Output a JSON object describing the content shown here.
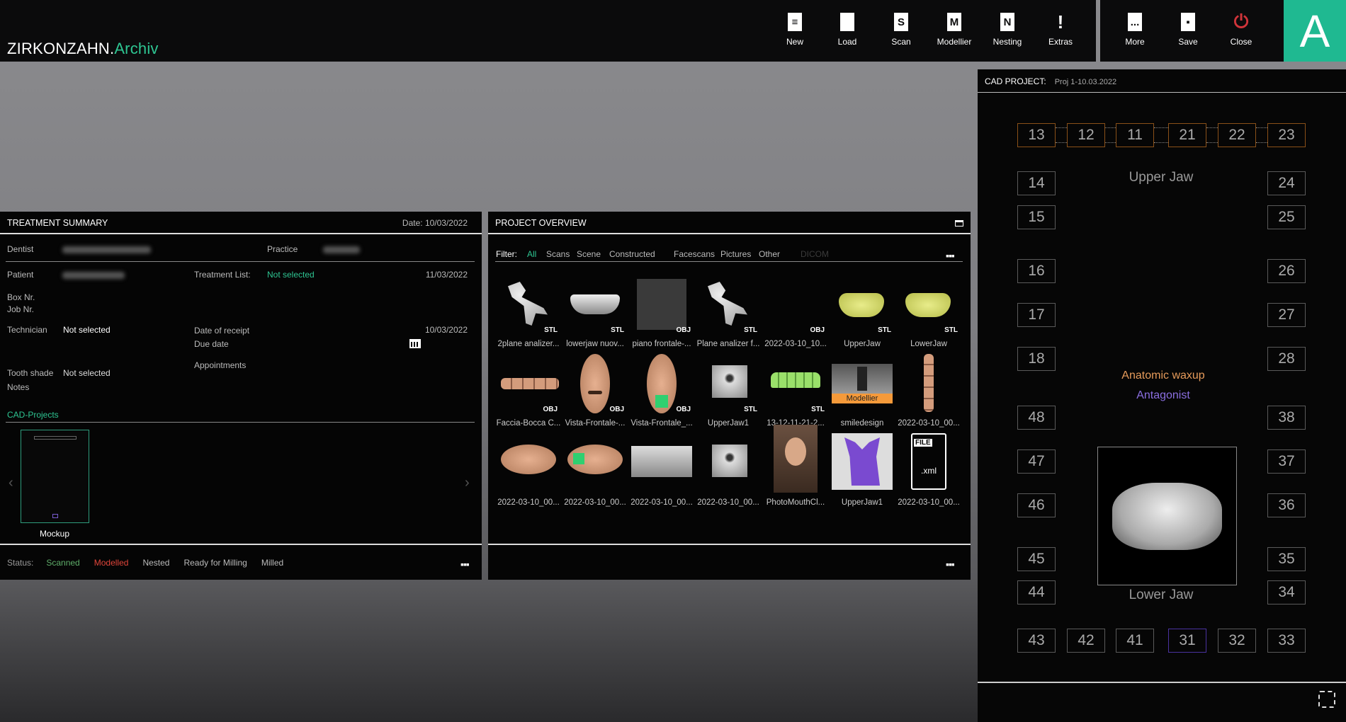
{
  "app": {
    "brand": "ZIRKONZAHN.",
    "product": "Archiv",
    "user_initial": "A",
    "accent": "#1fb991"
  },
  "toolbar": [
    {
      "label": "New",
      "icon": "new-file-icon",
      "glyph": "≡"
    },
    {
      "label": "Load",
      "icon": "folder-icon",
      "glyph": ""
    },
    {
      "label": "Scan",
      "icon": "scan-icon",
      "glyph": "S"
    },
    {
      "label": "Modellier",
      "icon": "modellier-icon",
      "glyph": "M"
    },
    {
      "label": "Nesting",
      "icon": "nesting-icon",
      "glyph": "N"
    },
    {
      "label": "Extras",
      "icon": "exclamation-icon",
      "glyph": "!"
    }
  ],
  "toolbar2": [
    {
      "label": "More",
      "icon": "more-icon",
      "glyph": "..."
    },
    {
      "label": "Save",
      "icon": "save-icon",
      "glyph": "▪"
    },
    {
      "label": "Close",
      "icon": "power-icon",
      "glyph": "⏻"
    }
  ],
  "treatment": {
    "title": "TREATMENT SUMMARY",
    "date": "Date: 10/03/2022",
    "dentist_label": "Dentist",
    "practice_label": "Practice",
    "patient_label": "Patient",
    "treatment_list_label": "Treatment List:",
    "treatment_list_value": "Not selected",
    "patient_date": "11/03/2022",
    "box_label": "Box Nr.",
    "job_label": "Job Nr.",
    "technician_label": "Technician",
    "technician_value": "Not selected",
    "receipt_label": "Date of receipt",
    "receipt_value": "10/03/2022",
    "due_label": "Due date",
    "appointments_label": "Appointments",
    "shade_label": "Tooth shade",
    "shade_value": "Not selected",
    "notes_label": "Notes",
    "cad_projects_label": "CAD-Projects",
    "project_name": "Mockup",
    "status_label": "Status:",
    "statuses": [
      {
        "label": "Scanned",
        "color": "#5fae6a"
      },
      {
        "label": "Modelled",
        "color": "#e0453a"
      },
      {
        "label": "Nested",
        "color": "#bbbbbb"
      },
      {
        "label": "Ready for Milling",
        "color": "#bbbbbb"
      },
      {
        "label": "Milled",
        "color": "#bbbbbb"
      }
    ]
  },
  "overview": {
    "title": "PROJECT OVERVIEW",
    "filter_label": "Filter:",
    "filters": [
      "All",
      "Scans",
      "Scene",
      "Constructed",
      "Facescans",
      "Pictures",
      "Other",
      "DICOM"
    ],
    "active_filter": "All",
    "files": [
      {
        "name": "2plane analizer...",
        "type": "STL",
        "thumb": "arch-white"
      },
      {
        "name": "lowerjaw nuov...",
        "type": "STL",
        "thumb": "jaw-white"
      },
      {
        "name": "piano frontale-...",
        "type": "OBJ",
        "thumb": "grey-square"
      },
      {
        "name": "Plane analizer f...",
        "type": "STL",
        "thumb": "arch-white"
      },
      {
        "name": "2022-03-10_10...",
        "type": "OBJ",
        "thumb": "empty"
      },
      {
        "name": "UpperJaw",
        "type": "STL",
        "thumb": "jaw-yellow"
      },
      {
        "name": "LowerJaw",
        "type": "STL",
        "thumb": "jaw-yellow"
      },
      {
        "name": "Faccia-Bocca C...",
        "type": "OBJ",
        "thumb": "face-strip"
      },
      {
        "name": "Vista-Frontale-...",
        "type": "OBJ",
        "thumb": "face"
      },
      {
        "name": "Vista-Frontale_...",
        "type": "OBJ",
        "thumb": "face-green"
      },
      {
        "name": "UpperJaw1",
        "type": "STL",
        "thumb": "model-white"
      },
      {
        "name": "13-12-11-21-2...",
        "type": "STL",
        "thumb": "teeth-green"
      },
      {
        "name": "smiledesign",
        "type": "",
        "thumb": "modellier",
        "badge": "Modellier"
      },
      {
        "name": "2022-03-10_00...",
        "type": "",
        "thumb": "face-vertical"
      },
      {
        "name": "2022-03-10_00...",
        "type": "",
        "thumb": "face-side"
      },
      {
        "name": "2022-03-10_00...",
        "type": "",
        "thumb": "face-side-green"
      },
      {
        "name": "2022-03-10_00...",
        "type": "",
        "thumb": "grey-gradient"
      },
      {
        "name": "2022-03-10_00...",
        "type": "",
        "thumb": "model-white"
      },
      {
        "name": "PhotoMouthCl...",
        "type": "",
        "thumb": "photo"
      },
      {
        "name": "UpperJaw1",
        "type": "",
        "thumb": "model-purple"
      },
      {
        "name": "2022-03-10_00...",
        "type": "",
        "thumb": "xml-file",
        "file_badge": "FILE",
        "file_ext": ".xml"
      }
    ]
  },
  "cad": {
    "label": "CAD PROJECT:",
    "value": "Proj 1-10.03.2022",
    "upper_jaw": "Upper Jaw",
    "lower_jaw": "Lower Jaw",
    "anatomic": "Anatomic waxup",
    "antagonist": "Antagonist",
    "anatomic_color": "#e59a5a",
    "antagonist_color": "#8a6ee0",
    "teeth_top": [
      {
        "n": "13",
        "s": "sel"
      },
      {
        "n": "12",
        "s": "sel"
      },
      {
        "n": "11",
        "s": "sel"
      },
      {
        "n": "21",
        "s": "sel"
      },
      {
        "n": "22",
        "s": "sel"
      },
      {
        "n": "23",
        "s": "sel"
      }
    ],
    "teeth_left": [
      "14",
      "15",
      "16",
      "17",
      "18",
      "48",
      "47",
      "46",
      "45",
      "44"
    ],
    "teeth_right": [
      "24",
      "25",
      "26",
      "27",
      "28",
      "38",
      "37",
      "36",
      "35",
      "34"
    ],
    "teeth_bottom": [
      {
        "n": "43",
        "s": ""
      },
      {
        "n": "42",
        "s": ""
      },
      {
        "n": "41",
        "s": ""
      },
      {
        "n": "31",
        "s": "ant"
      },
      {
        "n": "32",
        "s": ""
      },
      {
        "n": "33",
        "s": ""
      }
    ]
  }
}
